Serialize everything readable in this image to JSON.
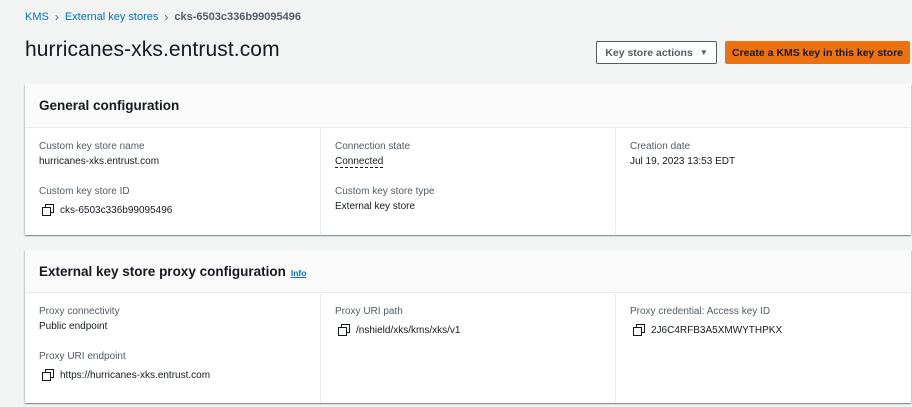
{
  "breadcrumb": {
    "items": [
      "KMS",
      "External key stores"
    ],
    "current": "cks-6503c336b99095496"
  },
  "page_title": "hurricanes-xks.entrust.com",
  "actions": {
    "key_store_actions_label": "Key store actions",
    "create_key_label": "Create a KMS key in this key store"
  },
  "general": {
    "title": "General configuration",
    "custom_key_store_name_label": "Custom key store name",
    "custom_key_store_name": "hurricanes-xks.entrust.com",
    "custom_key_store_id_label": "Custom key store ID",
    "custom_key_store_id": "cks-6503c336b99095496",
    "connection_state_label": "Connection state",
    "connection_state": "Connected",
    "custom_key_store_type_label": "Custom key store type",
    "custom_key_store_type": "External key store",
    "creation_date_label": "Creation date",
    "creation_date": "Jul 19, 2023 13:53 EDT"
  },
  "proxy": {
    "title": "External key store proxy configuration",
    "info_label": "Info",
    "proxy_connectivity_label": "Proxy connectivity",
    "proxy_connectivity": "Public endpoint",
    "proxy_uri_endpoint_label": "Proxy URI endpoint",
    "proxy_uri_endpoint": "https://hurricanes-xks.entrust.com",
    "proxy_uri_path_label": "Proxy URI path",
    "proxy_uri_path": "/nshield/xks/kms/xks/v1",
    "proxy_credential_label": "Proxy credential: Access key ID",
    "proxy_credential": "2J6C4RFB3A5XMWYTHPKX"
  },
  "colors": {
    "link": "#0073bb",
    "primary_button": "#ec7211",
    "page_background": "#f2f3f3"
  },
  "icons": [
    "copy-icon",
    "caret-down-icon",
    "breadcrumb-chevron-icon"
  ]
}
